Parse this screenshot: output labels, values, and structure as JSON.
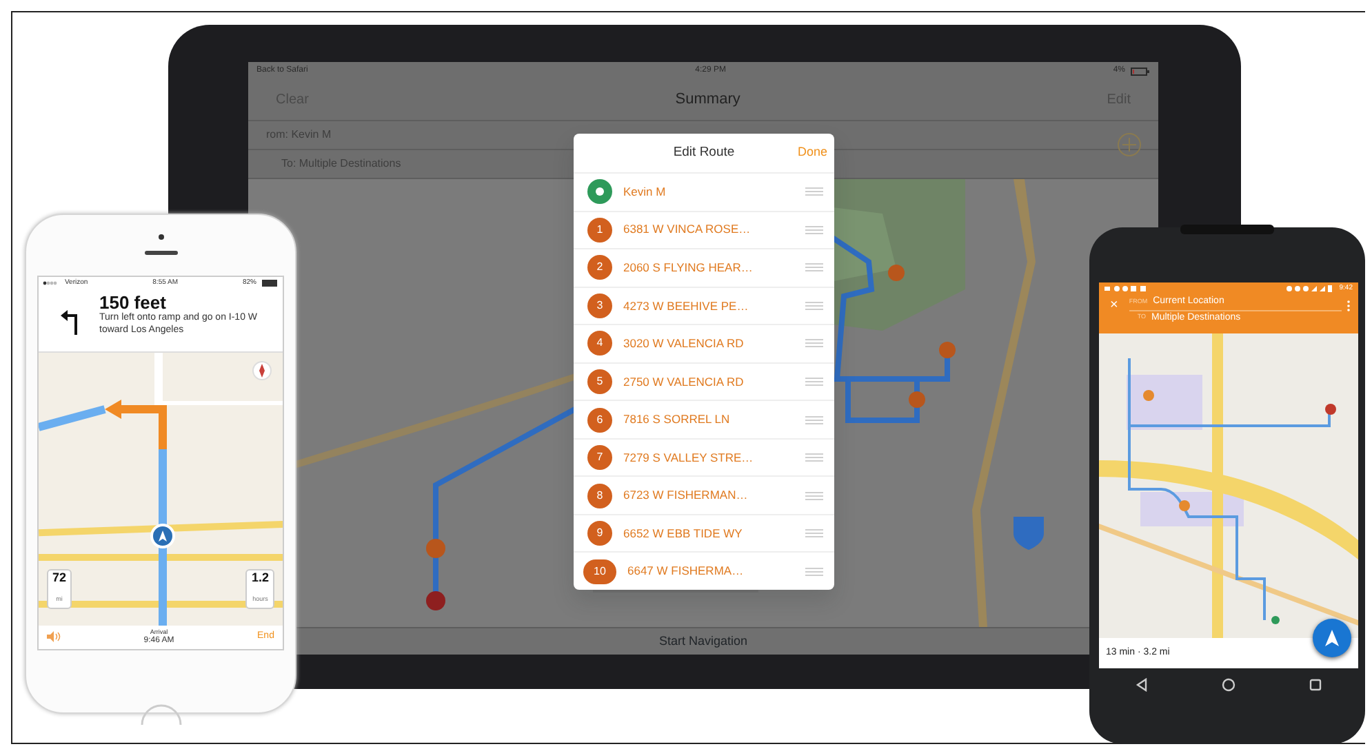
{
  "tablet": {
    "status_bar": {
      "left": "Back to Safari",
      "time": "4:29 PM",
      "battery": "4%"
    },
    "nav": {
      "left": "Clear",
      "title": "Summary",
      "right": "Edit"
    },
    "from": "rom: Kevin M",
    "to": "To: Multiple Destinations",
    "bottom_button": "Start Navigation",
    "dialog": {
      "title": "Edit Route",
      "done": "Done",
      "stops": [
        {
          "kind": "origin",
          "label": "Kevin M"
        },
        {
          "kind": "stop",
          "number": "1",
          "label": "6381 W VINCA ROSE…"
        },
        {
          "kind": "stop",
          "number": "2",
          "label": "2060 S FLYING HEAR…"
        },
        {
          "kind": "stop",
          "number": "3",
          "label": "4273 W BEEHIVE PE…"
        },
        {
          "kind": "stop",
          "number": "4",
          "label": "3020 W VALENCIA RD"
        },
        {
          "kind": "stop",
          "number": "5",
          "label": "2750 W VALENCIA RD"
        },
        {
          "kind": "stop",
          "number": "6",
          "label": "7816 S SORREL LN"
        },
        {
          "kind": "stop",
          "number": "7",
          "label": "7279 S VALLEY STRE…"
        },
        {
          "kind": "stop",
          "number": "8",
          "label": "6723 W FISHERMAN…"
        },
        {
          "kind": "stop",
          "number": "9",
          "label": "6652 W EBB TIDE WY"
        },
        {
          "kind": "stop",
          "number": "10",
          "label": "6647 W FISHERMA…"
        }
      ]
    }
  },
  "iphone": {
    "status_bar": {
      "carrier": "Verizon",
      "time": "8:55 AM",
      "battery": "82%"
    },
    "instruction": {
      "distance": "150 feet",
      "text": "Turn left onto ramp and go on I-10 W toward Los Angeles"
    },
    "speed": {
      "value": "72",
      "unit": "mi"
    },
    "remaining": {
      "value": "1.2",
      "unit": "hours"
    },
    "arrival": {
      "label": "Arrival",
      "time": "9:46 AM"
    },
    "end": "End"
  },
  "android": {
    "status_bar": {
      "time": "9:42"
    },
    "close": "×",
    "from_label": "FROM",
    "from": "Current Location",
    "to_label": "TO",
    "to": "Multiple Destinations",
    "summary": "13 min · 3.2 mi"
  }
}
